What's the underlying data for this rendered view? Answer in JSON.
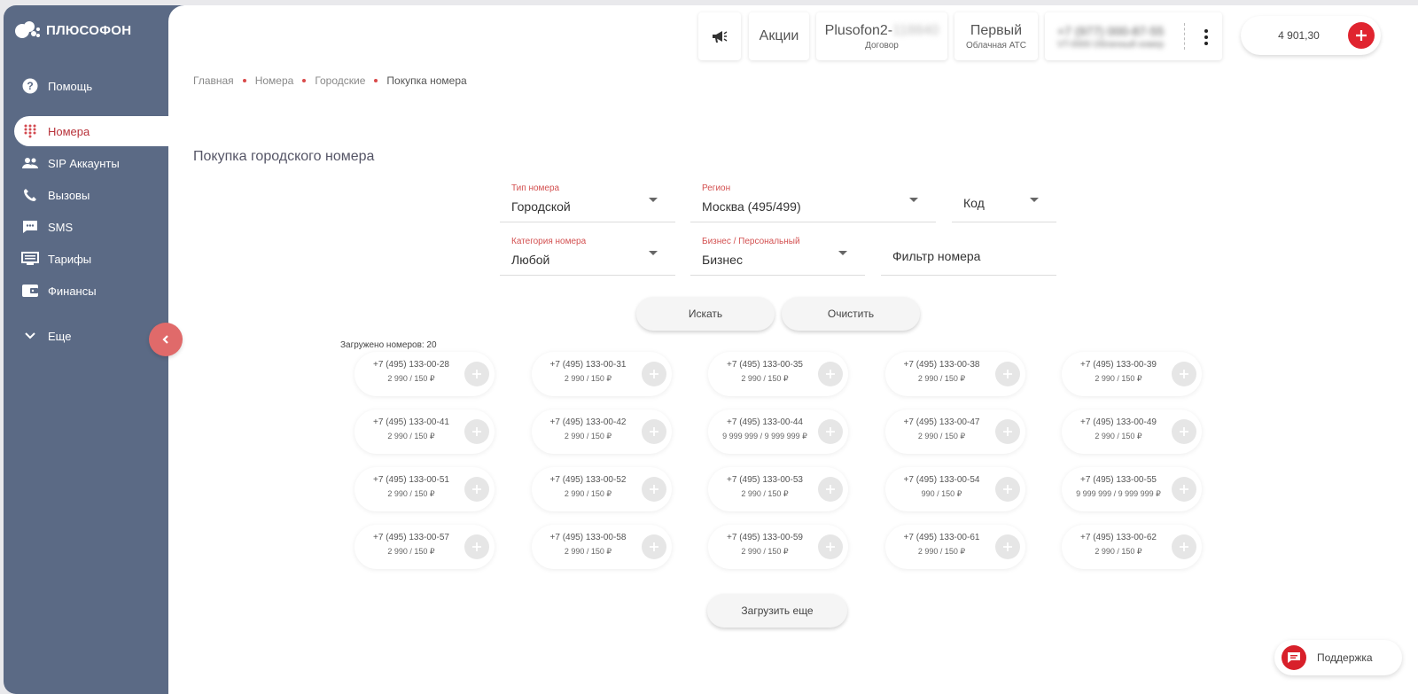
{
  "brand": {
    "name": "ПЛЮСОФОН"
  },
  "sidebar": {
    "items": [
      {
        "label": "Помощь",
        "icon": "help-icon"
      },
      {
        "label": "Номера",
        "icon": "dialpad-icon",
        "active": true
      },
      {
        "label": "SIP Аккаунты",
        "icon": "users-icon"
      },
      {
        "label": "Вызовы",
        "icon": "phone-icon"
      },
      {
        "label": "SMS",
        "icon": "sms-icon"
      },
      {
        "label": "Тарифы",
        "icon": "tariff-icon"
      },
      {
        "label": "Финансы",
        "icon": "wallet-icon"
      },
      {
        "label": "Еще",
        "icon": "chevron-down-icon"
      }
    ]
  },
  "header": {
    "promo_label": "Акции",
    "contract_title": "Plusofon2-",
    "contract_hidden": "118840",
    "contract_sub": "Договор",
    "pbx_title": "Первый",
    "pbx_sub": "Облачная АТС",
    "phone_hidden": "+7 (977) 000-87-55",
    "phone_sub_hidden": "VT-0000 Облачный номер",
    "balance": "4 901,30"
  },
  "breadcrumb": [
    "Главная",
    "Номера",
    "Городские",
    "Покупка номера"
  ],
  "page": {
    "title": "Покупка городского номера"
  },
  "filters": {
    "type": {
      "label": "Тип номера",
      "value": "Городской"
    },
    "region": {
      "label": "Регион",
      "value": "Москва (495/499)"
    },
    "code": {
      "value": "Код"
    },
    "category": {
      "label": "Категория номера",
      "value": "Любой"
    },
    "business": {
      "label": "Бизнес / Персональный",
      "value": "Бизнес"
    },
    "number_filter": {
      "placeholder": "Фильтр номера"
    }
  },
  "actions": {
    "search": "Искать",
    "clear": "Очистить",
    "load_more": "Загрузить еще"
  },
  "results": {
    "loaded_text": "Загружено номеров: 20",
    "numbers": [
      {
        "phone": "+7 (495) 133-00-28",
        "price": "2 990 / 150 ₽"
      },
      {
        "phone": "+7 (495) 133-00-31",
        "price": "2 990 / 150 ₽"
      },
      {
        "phone": "+7 (495) 133-00-35",
        "price": "2 990 / 150 ₽"
      },
      {
        "phone": "+7 (495) 133-00-38",
        "price": "2 990 / 150 ₽"
      },
      {
        "phone": "+7 (495) 133-00-39",
        "price": "2 990 / 150 ₽"
      },
      {
        "phone": "+7 (495) 133-00-41",
        "price": "2 990 / 150 ₽"
      },
      {
        "phone": "+7 (495) 133-00-42",
        "price": "2 990 / 150 ₽"
      },
      {
        "phone": "+7 (495) 133-00-44",
        "price": "9 999 999 / 9 999 999 ₽"
      },
      {
        "phone": "+7 (495) 133-00-47",
        "price": "2 990 / 150 ₽"
      },
      {
        "phone": "+7 (495) 133-00-49",
        "price": "2 990 / 150 ₽"
      },
      {
        "phone": "+7 (495) 133-00-51",
        "price": "2 990 / 150 ₽"
      },
      {
        "phone": "+7 (495) 133-00-52",
        "price": "2 990 / 150 ₽"
      },
      {
        "phone": "+7 (495) 133-00-53",
        "price": "2 990 / 150 ₽"
      },
      {
        "phone": "+7 (495) 133-00-54",
        "price": "990 / 150 ₽"
      },
      {
        "phone": "+7 (495) 133-00-55",
        "price": "9 999 999 / 9 999 999 ₽"
      },
      {
        "phone": "+7 (495) 133-00-57",
        "price": "2 990 / 150 ₽"
      },
      {
        "phone": "+7 (495) 133-00-58",
        "price": "2 990 / 150 ₽"
      },
      {
        "phone": "+7 (495) 133-00-59",
        "price": "2 990 / 150 ₽"
      },
      {
        "phone": "+7 (495) 133-00-61",
        "price": "2 990 / 150 ₽"
      },
      {
        "phone": "+7 (495) 133-00-62",
        "price": "2 990 / 150 ₽"
      }
    ]
  },
  "support": {
    "label": "Поддержка"
  },
  "colors": {
    "sidebar": "#5b6a85",
    "accent": "#e0242f",
    "active_text": "#b8323a",
    "label_red": "#d35050"
  }
}
